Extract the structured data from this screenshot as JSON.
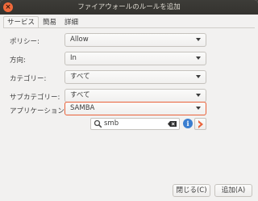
{
  "window": {
    "title": "ファイアウォールのルールを追加"
  },
  "tabs": [
    {
      "label": "サービス"
    },
    {
      "label": "簡易"
    },
    {
      "label": "詳細"
    }
  ],
  "form": {
    "policy": {
      "label": "ポリシー:",
      "value": "Allow"
    },
    "direction": {
      "label": "方向:",
      "value": "In"
    },
    "category": {
      "label": "カテゴリー:",
      "value": "すべて"
    },
    "subcategory": {
      "label": "サブカテゴリー:",
      "value": "すべて"
    },
    "application": {
      "label": "アプリケーション:",
      "value": "SAMBA"
    }
  },
  "search": {
    "value": "smb",
    "icon": "search-icon"
  },
  "buttons": {
    "close": "閉じる(C)",
    "add": "追加(A)"
  },
  "colors": {
    "accent": "#e9623a",
    "info": "#3a7ed0",
    "titlebar": "#3d3c38"
  }
}
